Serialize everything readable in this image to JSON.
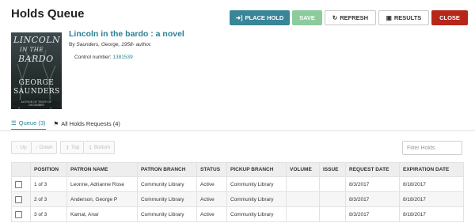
{
  "header": {
    "title": "Holds Queue"
  },
  "toolbar": {
    "place_hold": "PLACE HOLD",
    "save": "SAVE",
    "refresh": "REFRESH",
    "results": "RESULTS",
    "close": "CLOSE",
    "colors": {
      "place_hold": "#3a8597",
      "save": "#8ccb9d",
      "close": "#b5271a"
    }
  },
  "book": {
    "title": "Lincoln in the bardo : a novel",
    "by_prefix": "By",
    "author": "Saunders, George, 1958- author.",
    "control_label": "Control number:",
    "control_number": "1381539",
    "cover": {
      "title_line1": "LINCOLN",
      "title_line2": "IN THE",
      "title_line3": "BARDO",
      "author_line1": "GEORGE",
      "author_line2": "SAUNDERS",
      "footer": "AUTHOR OF TENTH OF DECEMBER"
    }
  },
  "tabs": [
    {
      "label": "Queue (3)"
    },
    {
      "label": "All Holds Requests (4)"
    }
  ],
  "move_buttons": {
    "up": "Up",
    "down": "Down",
    "top": "Top",
    "bottom": "Bottom"
  },
  "filter": {
    "placeholder": "Filter Holds"
  },
  "table": {
    "columns": [
      "POSITION",
      "PATRON NAME",
      "PATRON BRANCH",
      "STATUS",
      "PICKUP BRANCH",
      "VOLUME",
      "ISSUE",
      "REQUEST DATE",
      "EXPIRATION DATE"
    ],
    "rows": [
      {
        "position": "1 of 3",
        "patron": "Leonne, Adrianne Rose",
        "patron_branch": "Community Library",
        "status": "Active",
        "pickup": "Community Library",
        "volume": "",
        "issue": "",
        "request_date": "8/3/2017",
        "expiration": "8/18/2017"
      },
      {
        "position": "2 of 3",
        "patron": "Anderson, George P",
        "patron_branch": "Community Library",
        "status": "Active",
        "pickup": "Community Library",
        "volume": "",
        "issue": "",
        "request_date": "8/3/2017",
        "expiration": "8/18/2017"
      },
      {
        "position": "3 of 3",
        "patron": "Kamat, Anar",
        "patron_branch": "Community Library",
        "status": "Active",
        "pickup": "Community Library",
        "volume": "",
        "issue": "",
        "request_date": "8/3/2017",
        "expiration": "8/18/2017"
      }
    ]
  }
}
